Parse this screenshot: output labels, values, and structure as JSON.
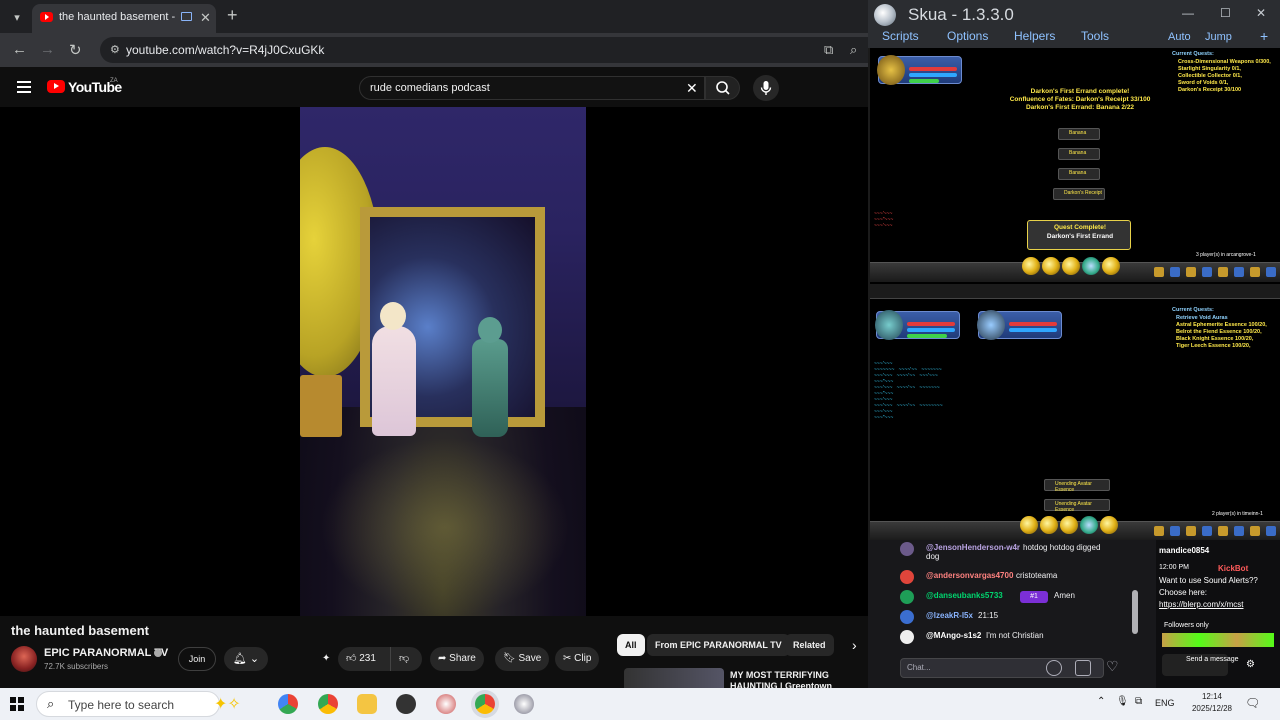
{
  "browser": {
    "tab_title": "the haunted basement - YouTube",
    "new_tab": "+",
    "url": "youtube.com/watch?v=R4jJ0CxuGKk"
  },
  "youtube": {
    "wordmark": "YouTube",
    "country_code": "ZA",
    "search_query": "rude comedians podcast",
    "video_title": "the haunted basement",
    "channel_name": "EPIC PARANORMAL TV",
    "subscribers": "72.7K subscribers",
    "join_label": "Join",
    "like_count": "231",
    "share_label": "Share",
    "save_label": "Save",
    "clip_label": "Clip",
    "chips": [
      "All",
      "From EPIC PARANORMAL TV",
      "Related"
    ],
    "recommended_title": "MY MOST TERRIFYING HAUNTING | Greentown School"
  },
  "skua": {
    "title": "Skua - 1.3.3.0",
    "menu": [
      "Scripts",
      "Options",
      "Helpers",
      "Tools"
    ],
    "right_menu": [
      "Auto",
      "Jump"
    ],
    "panel1": {
      "quests_head": "Current Quests:",
      "quests": [
        "Cross-Dimensional Weapons 0/300,",
        "Starlight Singularity 0/1,",
        "Collectible Collector 0/1,",
        "Sword of Voids 0/1,",
        "Darkon's Receipt 30/100"
      ],
      "center_lines": [
        "Darkon's First Errand complete!",
        "Confluence of Fates: Darkon's Receipt 33/100",
        "Darkon's First Errand: Banana 2/22"
      ],
      "drops": [
        "Banana",
        "Banana",
        "Banana",
        "Darkon's Receipt"
      ],
      "quest_complete": "Quest Complete!",
      "quest_complete_name": "Darkon's First Errand",
      "players": "3 player(s) in arcangrove-1"
    },
    "panel2": {
      "quests_head": "Current Quests:",
      "quests": [
        "Retrieve Void Auras",
        "Astral Ephemerite Essence 100/20,",
        "Belrot the Fiend Essence 100/20,",
        "Black Knight Essence 100/20,",
        "Tiger Leech Essence 100/20,"
      ],
      "drops": [
        "Unending Avatar Essence",
        "Unending Avatar Essence"
      ],
      "players": "2 player(s) in timeinn-1"
    }
  },
  "chat": {
    "rows": [
      {
        "user": "@JensonHenderson-w4r",
        "msg": "hotdog hotdog digged",
        "msg2": "dog",
        "color": "#b9a3e3"
      },
      {
        "user": "@andersonvargas4700",
        "msg": "cristoteama",
        "color": "#ff8280"
      },
      {
        "user": "@danseubanks5733",
        "msg": "Amen",
        "badge": "#1",
        "color": "#00d66f"
      },
      {
        "user": "@lzeakR-l5x",
        "msg": "21:15",
        "color": "#8ab4ff"
      },
      {
        "user": "@MAngo-s1s2",
        "msg": "I'm not Christian",
        "color": "#ffffff"
      }
    ],
    "input_placeholder": "Chat...",
    "side": {
      "username": "mandice0854",
      "time": "12:00 PM",
      "bot": "KickBot",
      "line1": "Want to use Sound Alerts??",
      "line2": "Choose here:",
      "link": "https://blerp.com/x/mcst",
      "followers_only": "Followers only",
      "send": "Send a message"
    }
  },
  "taskbar": {
    "search_placeholder": "Type here to search",
    "lang": "ENG",
    "time": "12:14",
    "date": "2025/12/28"
  }
}
